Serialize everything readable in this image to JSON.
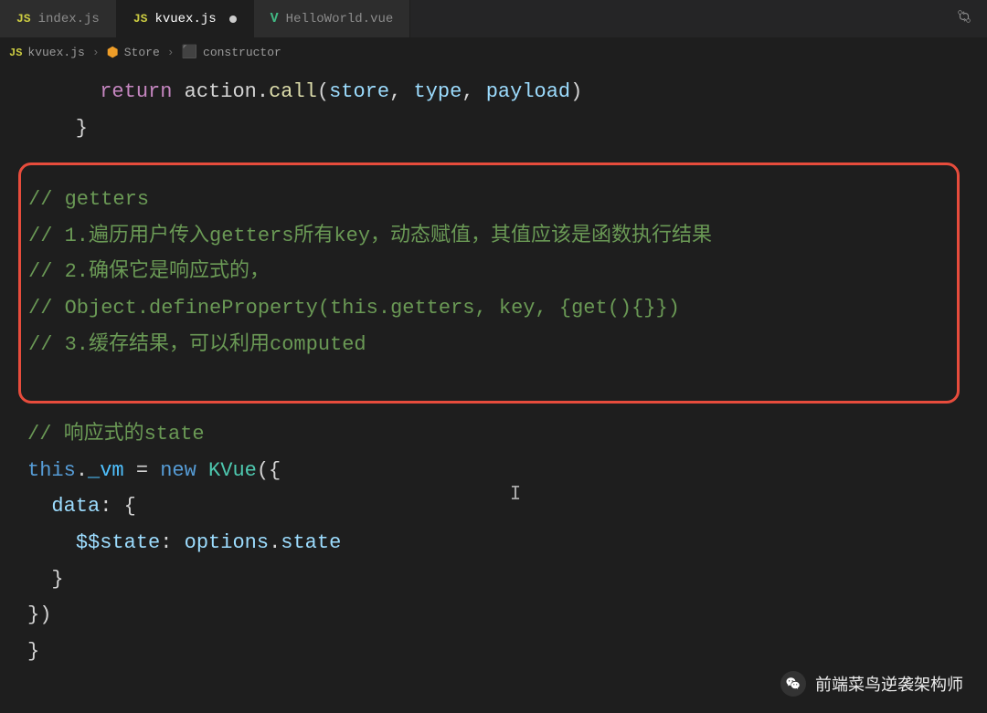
{
  "tabs": [
    {
      "icon": "JS",
      "label": "index.js",
      "active": false,
      "modified": false,
      "iconType": "js"
    },
    {
      "icon": "JS",
      "label": "kvuex.js",
      "active": true,
      "modified": true,
      "iconType": "js"
    },
    {
      "icon": "V",
      "label": "HelloWorld.vue",
      "active": false,
      "modified": false,
      "iconType": "vue"
    }
  ],
  "breadcrumb": {
    "file_icon": "JS",
    "file": "kvuex.js",
    "class": "Store",
    "method": "constructor"
  },
  "code": {
    "l1_pre": "      ",
    "l1_kw": "return",
    "l1_mid": " action.",
    "l1_fn": "call",
    "l1_paren_o": "(",
    "l1_arg1": "store",
    "l1_c1": ", ",
    "l1_arg2": "type",
    "l1_c2": ", ",
    "l1_arg3": "payload",
    "l1_paren_c": ")",
    "l2": "    }",
    "c1": "// getters",
    "c2": "// 1.遍历用户传入getters所有key，动态赋值，其值应该是函数执行结果",
    "c3": "// 2.确保它是响应式的，",
    "c4": "// Object.defineProperty(this.getters, key, {get(){}})",
    "c5": "// 3.缓存结果，可以利用computed",
    "c6": "// 响应式的state",
    "vm_this": "this",
    "vm_dot": ".",
    "vm_prop": "_vm",
    "vm_eq": " = ",
    "vm_new": "new",
    "vm_sp": " ",
    "vm_class": "KVue",
    "vm_open": "({",
    "data_key": "data",
    "data_colon": ": {",
    "state_key": "$$state",
    "state_colon": ": ",
    "state_val1": "options",
    "state_dot": ".",
    "state_val2": "state",
    "close_inner": "  }",
    "close_outer": "})",
    "close_block": "}"
  },
  "watermark": "前端菜鸟逆袭架构师"
}
